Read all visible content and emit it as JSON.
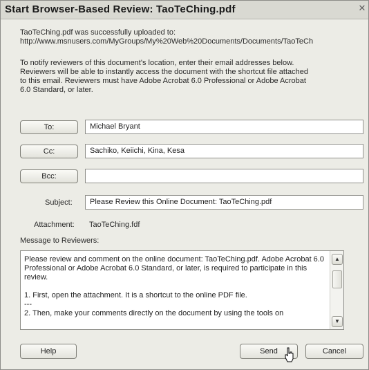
{
  "dialog": {
    "title": "Start Browser-Based Review: TaoTeChing.pdf",
    "close_glyph": "✕"
  },
  "upload": {
    "line1": "TaoTeChing.pdf was successfully uploaded to:",
    "url": "http://www.msnusers.com/MyGroups/My%20Web%20Documents/Documents/TaoTeCh"
  },
  "instructions": [
    "To notify reviewers of this document's location, enter their email addresses below.",
    "Reviewers will be able to instantly access the document with the shortcut file attached",
    "to this email. Reviewers must have Adobe Acrobat 6.0 Professional or Adobe Acrobat",
    "6.0 Standard, or later."
  ],
  "fields": {
    "to_label": "To:",
    "to_value": "Michael Bryant",
    "cc_label": "Cc:",
    "cc_value": "Sachiko, Keiichi, Kina, Kesa",
    "bcc_label": "Bcc:",
    "bcc_value": "",
    "subject_label": "Subject:",
    "subject_value": "Please Review this Online Document: TaoTeChing.pdf",
    "attachment_label": "Attachment:",
    "attachment_value": "TaoTeChing.fdf"
  },
  "message": {
    "label": "Message to Reviewers:",
    "body": "Please review and comment on the online document: TaoTeChing.pdf. Adobe Acrobat 6.0 Professional or Adobe Acrobat 6.0 Standard, or later, is required to participate in this review.\n\n1. First, open the attachment. It is a shortcut to the online PDF file.\n---\n2. Then, make your comments directly on the document by using the tools on"
  },
  "buttons": {
    "help": "Help",
    "send": "Send",
    "cancel": "Cancel"
  },
  "scroll": {
    "up_glyph": "▲",
    "down_glyph": "▼"
  },
  "colors": {
    "dialog_bg": "#ecece6",
    "title_bg": "#d9d9d2"
  }
}
